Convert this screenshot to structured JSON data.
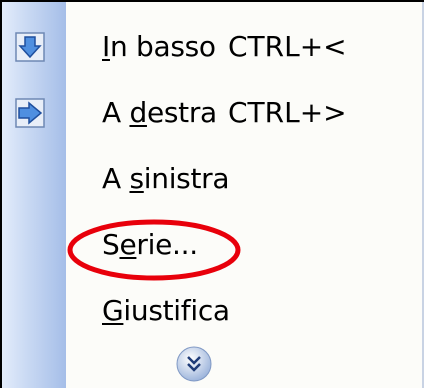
{
  "menu": {
    "items": [
      {
        "label_parts": [
          "",
          "I",
          "n basso"
        ],
        "shortcut": "CTRL+<",
        "icon": "arrow-down-icon"
      },
      {
        "label_parts": [
          "A ",
          "d",
          "estra"
        ],
        "shortcut": "CTRL+>",
        "icon": "arrow-right-icon"
      },
      {
        "label_parts": [
          "A ",
          "s",
          "inistra"
        ],
        "shortcut": "",
        "icon": ""
      },
      {
        "label_parts": [
          "S",
          "e",
          "rie..."
        ],
        "shortcut": "",
        "icon": ""
      },
      {
        "label_parts": [
          "",
          "G",
          "iustifica"
        ],
        "shortcut": "",
        "icon": ""
      }
    ],
    "more_icon": "double-chevron-down-icon"
  },
  "annotation": {
    "shape": "ellipse",
    "color": "#e8000b",
    "target": "Serie..."
  }
}
